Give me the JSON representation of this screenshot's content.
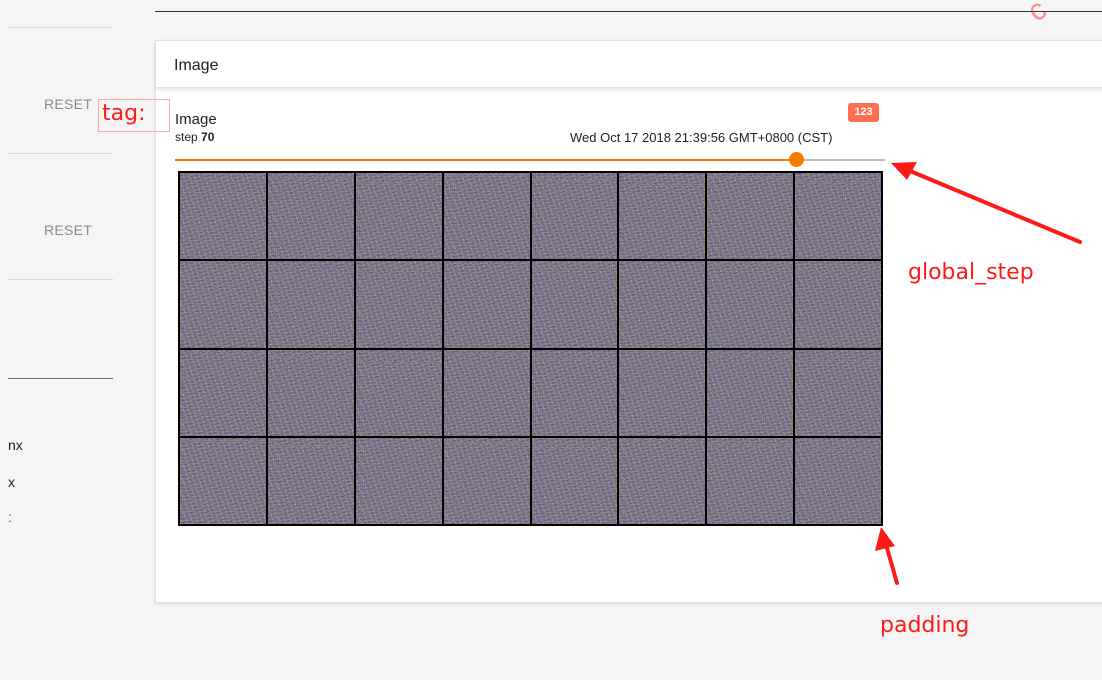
{
  "sidebar": {
    "reset_buttons": [
      "RESET",
      "RESET"
    ],
    "items": [
      "nx",
      "x",
      ":"
    ]
  },
  "card": {
    "title": "Image"
  },
  "image_panel": {
    "tag": "Image",
    "step_label": "step",
    "step_value": "70",
    "run_badge": "123",
    "timestamp": "Wed Oct 17 2018 21:39:56 GMT+0800 (CST)",
    "slider_fraction": 0.875,
    "grid": {
      "rows": 4,
      "columns": 8
    }
  },
  "annotations": {
    "tag_label": "tag:",
    "global_step_label": "global_step",
    "padding_label": "padding",
    "color": "#ff1a1a"
  },
  "watermark_text": "c",
  "colors": {
    "slider_accent": "#f57c00",
    "badge": "#ff6e50"
  }
}
